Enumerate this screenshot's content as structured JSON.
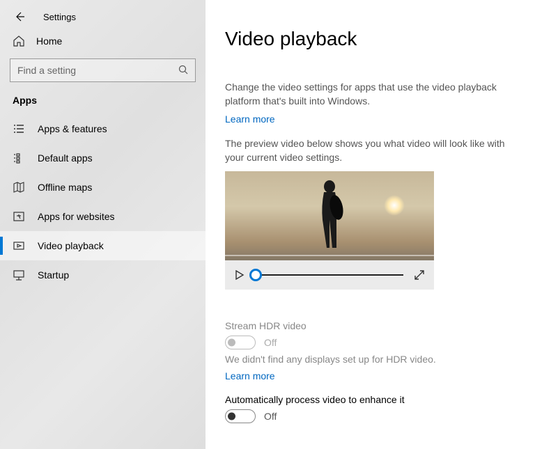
{
  "app": {
    "title": "Settings"
  },
  "sidebar": {
    "home_label": "Home",
    "search_placeholder": "Find a setting",
    "section_header": "Apps",
    "items": [
      {
        "label": "Apps & features",
        "icon": "apps-features"
      },
      {
        "label": "Default apps",
        "icon": "default-apps"
      },
      {
        "label": "Offline maps",
        "icon": "offline-maps"
      },
      {
        "label": "Apps for websites",
        "icon": "apps-websites"
      },
      {
        "label": "Video playback",
        "icon": "video-playback",
        "selected": true
      },
      {
        "label": "Startup",
        "icon": "startup"
      }
    ]
  },
  "main": {
    "title": "Video playback",
    "description": "Change the video settings for apps that use the video playback platform that's built into Windows.",
    "learn_more": "Learn more",
    "preview_text": "The preview video below shows you what video will look like with your current video settings.",
    "hdr": {
      "label": "Stream HDR video",
      "state": "Off",
      "note": "We didn't find any displays set up for HDR video.",
      "learn_more": "Learn more"
    },
    "auto_enhance": {
      "label": "Automatically process video to enhance it",
      "state": "Off"
    }
  }
}
